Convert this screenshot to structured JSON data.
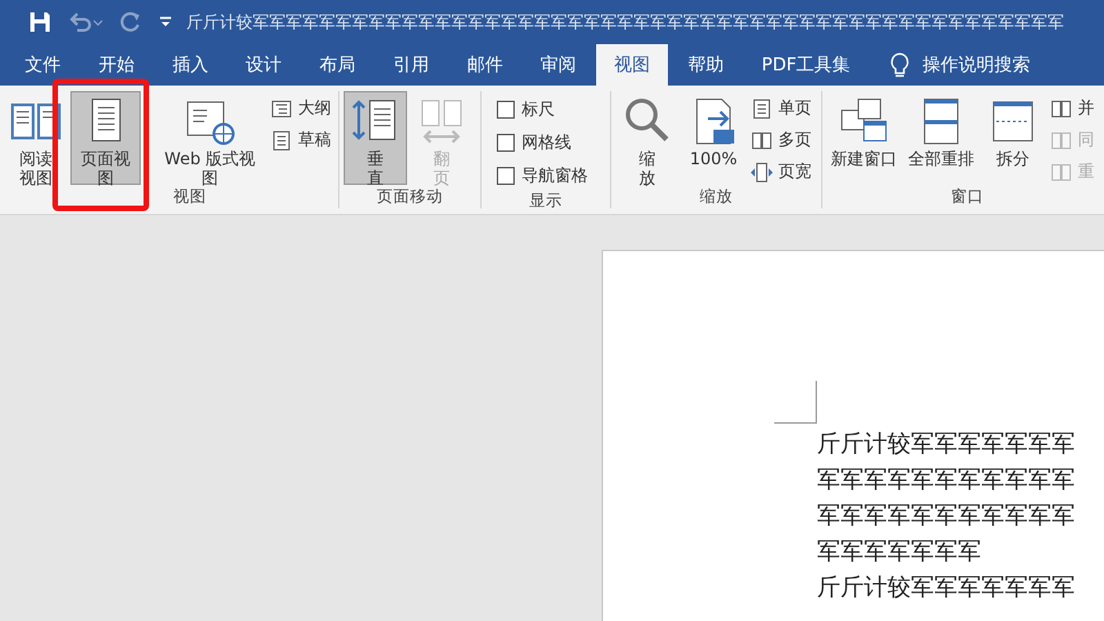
{
  "title_bar": {
    "title": "斤斤计较军军军军军军军军军军军军军军军军军军军军军军军军军军军军军军军军军军军军军军军军军军军军军军军军军",
    "quick_access": [
      {
        "kind": "save",
        "disabled": false
      },
      {
        "kind": "undo",
        "disabled": true
      },
      {
        "kind": "redo",
        "disabled": true
      },
      {
        "kind": "customize",
        "disabled": false
      }
    ]
  },
  "tabs": [
    {
      "label": "文件",
      "selected": false
    },
    {
      "label": "开始",
      "selected": false
    },
    {
      "label": "插入",
      "selected": false
    },
    {
      "label": "设计",
      "selected": false
    },
    {
      "label": "布局",
      "selected": false
    },
    {
      "label": "引用",
      "selected": false
    },
    {
      "label": "邮件",
      "selected": false
    },
    {
      "label": "审阅",
      "selected": false
    },
    {
      "label": "视图",
      "selected": true
    },
    {
      "label": "帮助",
      "selected": false
    },
    {
      "label": "PDF工具集",
      "selected": false
    }
  ],
  "tell_me": {
    "label": "操作说明搜索"
  },
  "ribbon": {
    "groups": [
      {
        "label": "视图",
        "items": [
          {
            "kind": "stacked",
            "label": "阅读视图",
            "selected": false,
            "disabled": false
          },
          {
            "kind": "large",
            "label": "页面视图",
            "selected": true,
            "disabled": false
          },
          {
            "kind": "large",
            "label": "Web 版式视图",
            "selected": false,
            "disabled": false
          },
          {
            "kind": "column",
            "items": [
              {
                "kind": "small",
                "label": "大纲",
                "disabled": false
              },
              {
                "kind": "small",
                "label": "草稿",
                "disabled": false
              }
            ]
          }
        ]
      },
      {
        "label": "页面移动",
        "items": [
          {
            "kind": "stacked",
            "label": "垂直",
            "selected": true,
            "disabled": false
          },
          {
            "kind": "stacked",
            "label": "翻页",
            "selected": false,
            "disabled": true
          }
        ]
      },
      {
        "label": "显示",
        "items": [
          {
            "kind": "column",
            "items": [
              {
                "kind": "check",
                "label": "标尺",
                "checked": false
              },
              {
                "kind": "check",
                "label": "网格线",
                "checked": false
              },
              {
                "kind": "check",
                "label": "导航窗格",
                "checked": false
              }
            ]
          }
        ]
      },
      {
        "label": "缩放",
        "items": [
          {
            "kind": "stacked",
            "label": "缩放",
            "selected": false,
            "disabled": false
          },
          {
            "kind": "large",
            "label": "100%",
            "selected": false,
            "disabled": false
          },
          {
            "kind": "column",
            "items": [
              {
                "kind": "small",
                "label": "单页",
                "disabled": false
              },
              {
                "kind": "small",
                "label": "多页",
                "disabled": false
              },
              {
                "kind": "small",
                "label": "页宽",
                "disabled": false
              }
            ]
          }
        ]
      },
      {
        "label": "窗口",
        "items": [
          {
            "kind": "large",
            "label": "新建窗口",
            "selected": false,
            "disabled": false
          },
          {
            "kind": "large",
            "label": "全部重排",
            "selected": false,
            "disabled": false
          },
          {
            "kind": "large",
            "label": "拆分",
            "selected": false,
            "disabled": false
          },
          {
            "kind": "column",
            "items": [
              {
                "kind": "small",
                "label": "并",
                "disabled": false
              },
              {
                "kind": "small",
                "label": "同",
                "disabled": true
              },
              {
                "kind": "small",
                "label": "重",
                "disabled": true
              }
            ]
          }
        ]
      }
    ]
  },
  "document": {
    "lines": [
      "斤斤计较军军军军军军军",
      "军军军军军军军军军军军",
      "军军军军军军军军军军军",
      "军军军军军军军",
      "斤斤计较军军军军军军军"
    ]
  }
}
